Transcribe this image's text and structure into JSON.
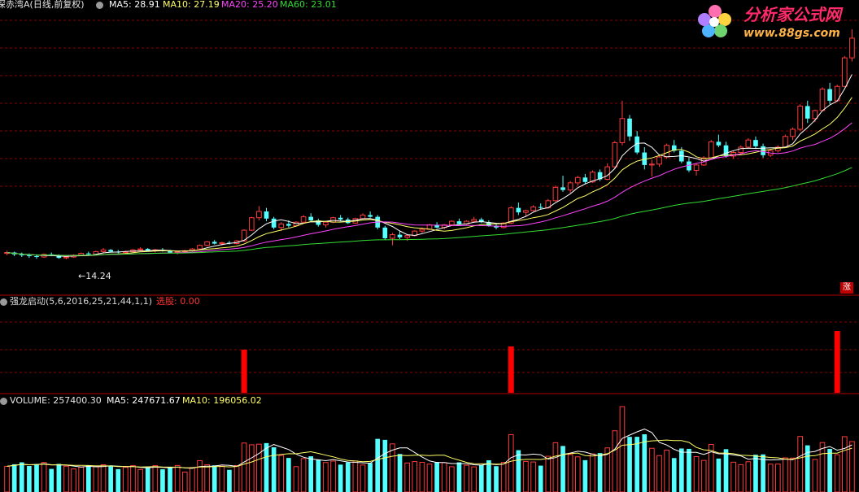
{
  "main_panel": {
    "title": "深赤湾A(日线,前复权)",
    "ma5_label": "MA5: 28.91",
    "ma10_label": "MA10: 27.19",
    "ma20_label": "MA20: 25.20",
    "ma60_label": "MA60: 23.01",
    "low_label": "←14.24",
    "zhang_label": "涨"
  },
  "indicator_panel": {
    "title": "强龙启动(5,6,2016,25,21,44,1,1)",
    "signal_label": "选股: 0.00"
  },
  "volume_panel": {
    "vol_label": "VOLUME: 257400.30",
    "ma5_label": "MA5: 247671.67",
    "ma10_label": "MA10: 196056.02"
  },
  "watermark": {
    "name": "分析家公式网",
    "url": "www.88gs.com"
  },
  "colors": {
    "up": "#ff3b3b",
    "down": "#54ffff",
    "ma5": "#ffffff",
    "ma10": "#ffff66",
    "ma20": "#ff44ff",
    "ma60": "#33dd33",
    "signal": "#ff0000",
    "grid": "#8b0000"
  },
  "chart_data": {
    "type": "candlestick",
    "candles": [
      [
        14.9,
        15.2,
        14.7,
        15.0
      ],
      [
        15.0,
        15.1,
        14.6,
        14.8
      ],
      [
        14.8,
        15.0,
        14.5,
        14.7
      ],
      [
        14.7,
        14.9,
        14.4,
        14.6
      ],
      [
        14.6,
        14.8,
        14.3,
        14.5
      ],
      [
        14.5,
        14.9,
        14.4,
        14.8
      ],
      [
        14.8,
        15.0,
        14.6,
        14.7
      ],
      [
        14.7,
        14.8,
        14.3,
        14.4
      ],
      [
        14.4,
        14.6,
        14.24,
        14.5
      ],
      [
        14.5,
        14.8,
        14.4,
        14.7
      ],
      [
        14.7,
        15.0,
        14.6,
        14.9
      ],
      [
        14.9,
        15.1,
        14.7,
        14.8
      ],
      [
        14.8,
        15.2,
        14.7,
        15.1
      ],
      [
        15.1,
        15.5,
        15.0,
        15.3
      ],
      [
        15.3,
        15.4,
        15.0,
        15.1
      ],
      [
        15.1,
        15.3,
        14.9,
        15.0
      ],
      [
        15.0,
        15.2,
        14.8,
        15.1
      ],
      [
        15.1,
        15.4,
        15.0,
        15.3
      ],
      [
        15.3,
        15.6,
        15.2,
        15.4
      ],
      [
        15.4,
        15.5,
        15.1,
        15.2
      ],
      [
        15.2,
        15.4,
        15.0,
        15.3
      ],
      [
        15.3,
        15.5,
        15.1,
        15.2
      ],
      [
        15.2,
        15.3,
        14.9,
        15.0
      ],
      [
        15.0,
        15.2,
        14.8,
        15.1
      ],
      [
        15.1,
        15.3,
        15.0,
        15.2
      ],
      [
        15.2,
        15.5,
        15.1,
        15.4
      ],
      [
        15.4,
        15.9,
        15.3,
        15.8
      ],
      [
        15.8,
        16.3,
        15.7,
        16.2
      ],
      [
        16.2,
        16.4,
        15.9,
        16.0
      ],
      [
        16.0,
        16.2,
        15.8,
        16.1
      ],
      [
        16.1,
        16.3,
        15.9,
        16.0
      ],
      [
        16.0,
        16.4,
        15.9,
        16.3
      ],
      [
        16.3,
        17.6,
        16.2,
        17.5
      ],
      [
        17.5,
        19.0,
        17.4,
        18.9
      ],
      [
        18.9,
        20.2,
        18.6,
        19.6
      ],
      [
        19.6,
        20.0,
        18.5,
        18.8
      ],
      [
        18.8,
        19.0,
        17.6,
        17.8
      ],
      [
        17.8,
        18.4,
        17.4,
        18.2
      ],
      [
        18.2,
        18.6,
        17.8,
        18.0
      ],
      [
        18.0,
        18.5,
        17.9,
        18.4
      ],
      [
        18.4,
        19.2,
        18.3,
        19.0
      ],
      [
        19.0,
        19.4,
        18.5,
        18.6
      ],
      [
        18.6,
        18.8,
        17.9,
        18.1
      ],
      [
        18.1,
        18.5,
        17.8,
        18.4
      ],
      [
        18.4,
        19.0,
        18.3,
        18.9
      ],
      [
        18.9,
        19.2,
        18.5,
        18.7
      ],
      [
        18.7,
        18.9,
        18.2,
        18.3
      ],
      [
        18.3,
        18.9,
        18.2,
        18.8
      ],
      [
        18.8,
        19.4,
        18.7,
        19.2
      ],
      [
        19.2,
        19.6,
        18.9,
        19.0
      ],
      [
        19.0,
        19.2,
        17.6,
        17.8
      ],
      [
        17.8,
        18.0,
        16.4,
        16.6
      ],
      [
        16.6,
        17.2,
        15.8,
        17.0
      ],
      [
        17.0,
        17.4,
        16.5,
        16.7
      ],
      [
        16.7,
        17.0,
        16.3,
        16.9
      ],
      [
        16.9,
        17.5,
        16.8,
        17.4
      ],
      [
        17.4,
        17.8,
        17.2,
        17.6
      ],
      [
        17.6,
        18.2,
        17.5,
        18.1
      ],
      [
        18.1,
        18.4,
        17.7,
        17.8
      ],
      [
        17.8,
        18.2,
        17.6,
        18.1
      ],
      [
        18.1,
        18.6,
        18.0,
        18.5
      ],
      [
        18.5,
        18.8,
        18.1,
        18.2
      ],
      [
        18.2,
        18.6,
        18.1,
        18.5
      ],
      [
        18.5,
        19.0,
        18.4,
        18.7
      ],
      [
        18.7,
        18.9,
        18.3,
        18.4
      ],
      [
        18.4,
        18.6,
        17.9,
        18.0
      ],
      [
        18.0,
        18.2,
        17.6,
        17.8
      ],
      [
        17.8,
        18.4,
        17.7,
        18.3
      ],
      [
        18.3,
        20.2,
        18.2,
        20.0
      ],
      [
        20.0,
        20.6,
        19.2,
        19.5
      ],
      [
        19.5,
        19.8,
        19.0,
        19.7
      ],
      [
        19.7,
        20.3,
        19.6,
        20.1
      ],
      [
        20.1,
        20.5,
        19.8,
        20.0
      ],
      [
        20.0,
        21.0,
        19.9,
        20.8
      ],
      [
        20.8,
        22.5,
        20.7,
        22.3
      ],
      [
        22.3,
        23.6,
        21.8,
        22.0
      ],
      [
        22.0,
        23.0,
        21.7,
        22.8
      ],
      [
        22.8,
        23.6,
        22.5,
        23.4
      ],
      [
        23.4,
        23.8,
        22.7,
        22.9
      ],
      [
        22.9,
        24.2,
        22.8,
        24.0
      ],
      [
        24.0,
        24.3,
        23.0,
        23.2
      ],
      [
        23.2,
        25.0,
        23.1,
        24.6
      ],
      [
        24.6,
        27.5,
        24.4,
        27.3
      ],
      [
        27.3,
        32.0,
        27.0,
        30.0
      ],
      [
        30.0,
        30.4,
        27.5,
        28.0
      ],
      [
        28.0,
        28.6,
        26.0,
        26.2
      ],
      [
        26.2,
        26.8,
        24.3,
        24.8
      ],
      [
        24.8,
        25.4,
        23.5,
        24.9
      ],
      [
        24.9,
        26.0,
        24.6,
        25.7
      ],
      [
        25.7,
        27.2,
        25.5,
        27.0
      ],
      [
        27.0,
        27.6,
        26.2,
        26.4
      ],
      [
        26.4,
        26.8,
        25.0,
        25.2
      ],
      [
        25.2,
        25.6,
        24.0,
        24.2
      ],
      [
        24.2,
        25.0,
        23.6,
        24.8
      ],
      [
        24.8,
        25.8,
        24.7,
        25.6
      ],
      [
        25.6,
        27.6,
        25.5,
        27.4
      ],
      [
        27.4,
        28.2,
        26.8,
        27.0
      ],
      [
        27.0,
        27.4,
        25.6,
        25.8
      ],
      [
        25.8,
        26.4,
        25.5,
        26.2
      ],
      [
        26.2,
        27.0,
        26.0,
        26.8
      ],
      [
        26.8,
        27.8,
        26.7,
        27.6
      ],
      [
        27.6,
        28.0,
        26.6,
        26.9
      ],
      [
        26.9,
        27.2,
        25.6,
        25.9
      ],
      [
        25.9,
        26.6,
        25.7,
        26.4
      ],
      [
        26.4,
        27.0,
        26.2,
        26.8
      ],
      [
        26.8,
        28.2,
        26.7,
        28.0
      ],
      [
        28.0,
        29.0,
        27.6,
        28.8
      ],
      [
        28.8,
        31.6,
        28.6,
        31.4
      ],
      [
        31.4,
        32.0,
        29.5,
        30.0
      ],
      [
        30.0,
        31.0,
        29.6,
        30.9
      ],
      [
        30.9,
        33.5,
        30.8,
        33.3
      ],
      [
        33.3,
        34.0,
        31.6,
        32.0
      ],
      [
        32.0,
        33.8,
        31.9,
        33.6
      ],
      [
        33.6,
        37.0,
        33.5,
        36.8
      ],
      [
        36.8,
        40.0,
        36.4,
        39.0
      ]
    ],
    "ma_lines": [
      "MA5",
      "MA10",
      "MA20",
      "MA60"
    ],
    "signals": [
      {
        "index": 32,
        "value": 1
      },
      {
        "index": 68,
        "value": 1
      },
      {
        "index": 112,
        "value": 1
      }
    ]
  }
}
